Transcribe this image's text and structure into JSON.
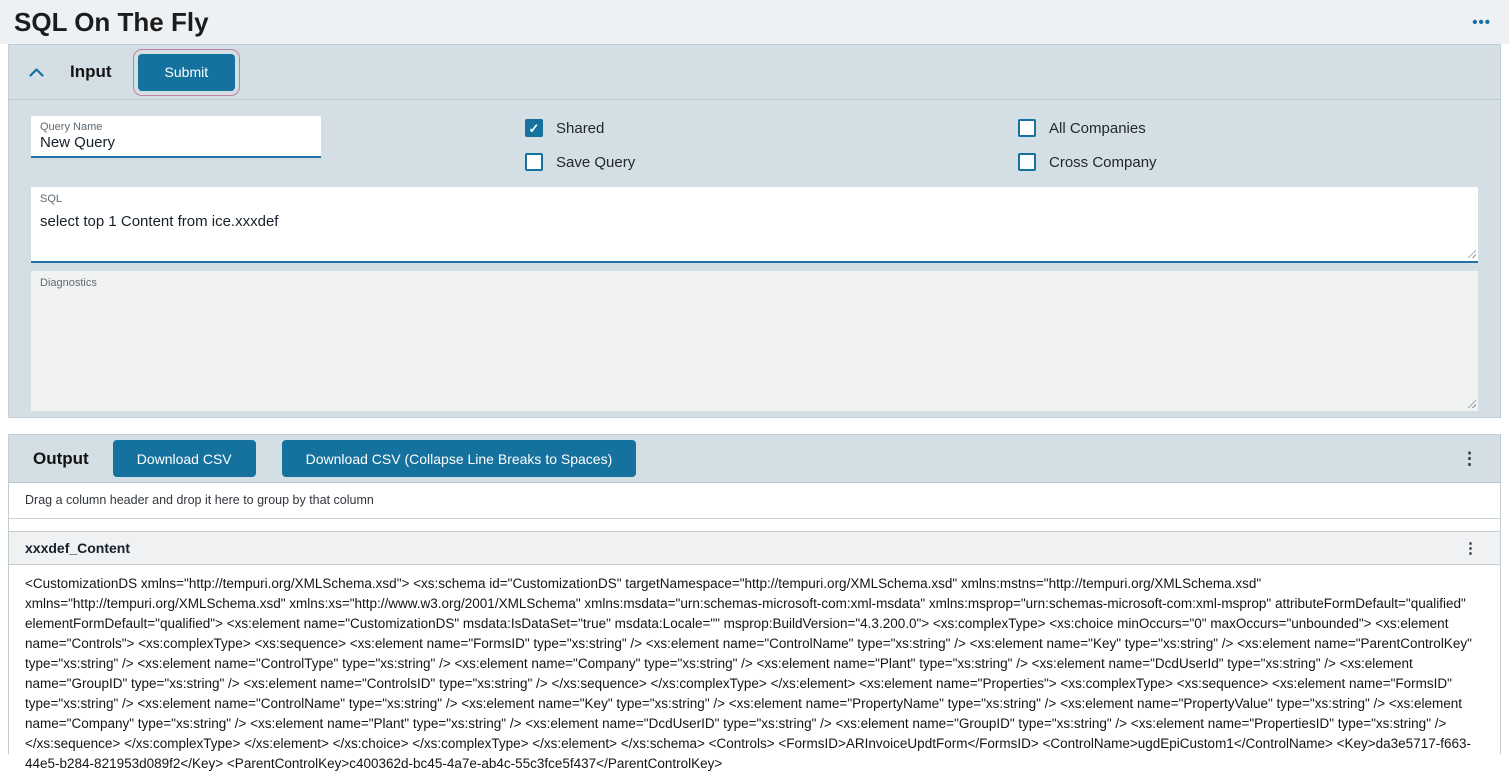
{
  "page": {
    "title": "SQL On The Fly"
  },
  "header": {
    "overflow_icon": "•••"
  },
  "input_section": {
    "title": "Input",
    "submit_label": "Submit",
    "query_name": {
      "label": "Query Name",
      "value": "New Query"
    },
    "checkboxes": [
      {
        "label": "Shared",
        "checked": true
      },
      {
        "label": "Save Query",
        "checked": false
      },
      {
        "label": "All Companies",
        "checked": false
      },
      {
        "label": "Cross Company",
        "checked": false
      }
    ],
    "sql": {
      "label": "SQL",
      "value": "select top 1 Content from ice.xxxdef"
    },
    "diagnostics": {
      "label": "Diagnostics",
      "value": ""
    }
  },
  "output_section": {
    "title": "Output",
    "download_csv_label": "Download CSV",
    "download_csv_collapse_label": "Download CSV (Collapse Line Breaks to Spaces)",
    "kebab_icon": "⋮",
    "group_hint": "Drag a column header and drop it here to group by that column",
    "table": {
      "columns": [
        "xxxdef_Content"
      ],
      "rows": [
        [
          "<CustomizationDS xmlns=\"http://tempuri.org/XMLSchema.xsd\"> <xs:schema id=\"CustomizationDS\" targetNamespace=\"http://tempuri.org/XMLSchema.xsd\" xmlns:mstns=\"http://tempuri.org/XMLSchema.xsd\" xmlns=\"http://tempuri.org/XMLSchema.xsd\" xmlns:xs=\"http://www.w3.org/2001/XMLSchema\" xmlns:msdata=\"urn:schemas-microsoft-com:xml-msdata\" xmlns:msprop=\"urn:schemas-microsoft-com:xml-msprop\" attributeFormDefault=\"qualified\" elementFormDefault=\"qualified\"> <xs:element name=\"CustomizationDS\" msdata:IsDataSet=\"true\" msdata:Locale=\"\" msprop:BuildVersion=\"4.3.200.0\"> <xs:complexType> <xs:choice minOccurs=\"0\" maxOccurs=\"unbounded\"> <xs:element name=\"Controls\"> <xs:complexType> <xs:sequence> <xs:element name=\"FormsID\" type=\"xs:string\" /> <xs:element name=\"ControlName\" type=\"xs:string\" /> <xs:element name=\"Key\" type=\"xs:string\" /> <xs:element name=\"ParentControlKey\" type=\"xs:string\" /> <xs:element name=\"ControlType\" type=\"xs:string\" /> <xs:element name=\"Company\" type=\"xs:string\" /> <xs:element name=\"Plant\" type=\"xs:string\" /> <xs:element name=\"DcdUserId\" type=\"xs:string\" /> <xs:element name=\"GroupID\" type=\"xs:string\" /> <xs:element name=\"ControlsID\" type=\"xs:string\" /> </xs:sequence> </xs:complexType> </xs:element> <xs:element name=\"Properties\"> <xs:complexType> <xs:sequence> <xs:element name=\"FormsID\" type=\"xs:string\" /> <xs:element name=\"ControlName\" type=\"xs:string\" /> <xs:element name=\"Key\" type=\"xs:string\" /> <xs:element name=\"PropertyName\" type=\"xs:string\" /> <xs:element name=\"PropertyValue\" type=\"xs:string\" /> <xs:element name=\"Company\" type=\"xs:string\" /> <xs:element name=\"Plant\" type=\"xs:string\" /> <xs:element name=\"DcdUserID\" type=\"xs:string\" /> <xs:element name=\"GroupID\" type=\"xs:string\" /> <xs:element name=\"PropertiesID\" type=\"xs:string\" /> </xs:sequence> </xs:complexType> </xs:element> </xs:choice> </xs:complexType> </xs:element> </xs:schema> <Controls> <FormsID>ARInvoiceUpdtForm</FormsID> <ControlName>ugdEpiCustom1</ControlName> <Key>da3e5717-f663-44e5-b284-821953d089f2</Key> <ParentControlKey>c400362d-bc45-4a7e-ab4c-55c3fce5f437</ParentControlKey>"
        ]
      ]
    }
  },
  "colors": {
    "accent_blue": "#15719e",
    "panel_background": "#d3dfe4",
    "focus_ring_pink": "#c180a7",
    "topbar_background": "#eef1f4"
  }
}
